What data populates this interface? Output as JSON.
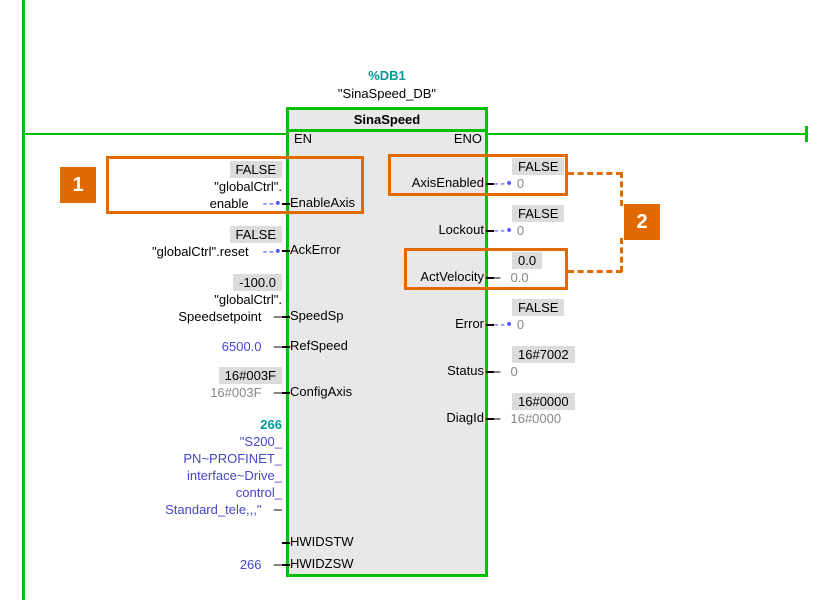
{
  "header": {
    "db_symbol": "%DB1",
    "db_name": "\"SinaSpeed_DB\"",
    "fb_title": "SinaSpeed",
    "en": "EN",
    "eno": "ENO"
  },
  "inputs": {
    "enableAxis": {
      "port": "EnableAxis",
      "value": "FALSE",
      "addr1": "\"globalCtrl\".",
      "addr2": "enable"
    },
    "ackError": {
      "port": "AckError",
      "value": "FALSE",
      "addr": "\"globalCtrl\".reset"
    },
    "speedSp": {
      "port": "SpeedSp",
      "value": "-100.0",
      "addr1": "\"globalCtrl\".",
      "addr2": "Speedsetpoint"
    },
    "refSpeed": {
      "port": "RefSpeed",
      "value": "6500.0"
    },
    "configAxis": {
      "port": "ConfigAxis",
      "value": "16#003F",
      "gray": "16#003F"
    },
    "hwidstw": {
      "port": "HWIDSTW",
      "value": "266",
      "addr1": "\"S200_",
      "addr2": "PN~PROFINET_",
      "addr3": "interface~Drive_",
      "addr4": "control_",
      "addr5": "Standard_tele,,,\""
    },
    "hwidzsw": {
      "port": "HWIDZSW",
      "value": "266"
    }
  },
  "outputs": {
    "axisEnabled": {
      "port": "AxisEnabled",
      "val": "FALSE",
      "live": "0"
    },
    "lockout": {
      "port": "Lockout",
      "val": "FALSE",
      "live": "0"
    },
    "actVelocity": {
      "port": "ActVelocity",
      "val": "0.0",
      "live": "0.0"
    },
    "error": {
      "port": "Error",
      "val": "FALSE",
      "live": "0"
    },
    "status": {
      "port": "Status",
      "val": "16#7002",
      "live": "0"
    },
    "diagId": {
      "port": "DiagId",
      "val": "16#0000",
      "live": "16#0000"
    }
  },
  "callouts": {
    "one": "1",
    "two": "2"
  }
}
